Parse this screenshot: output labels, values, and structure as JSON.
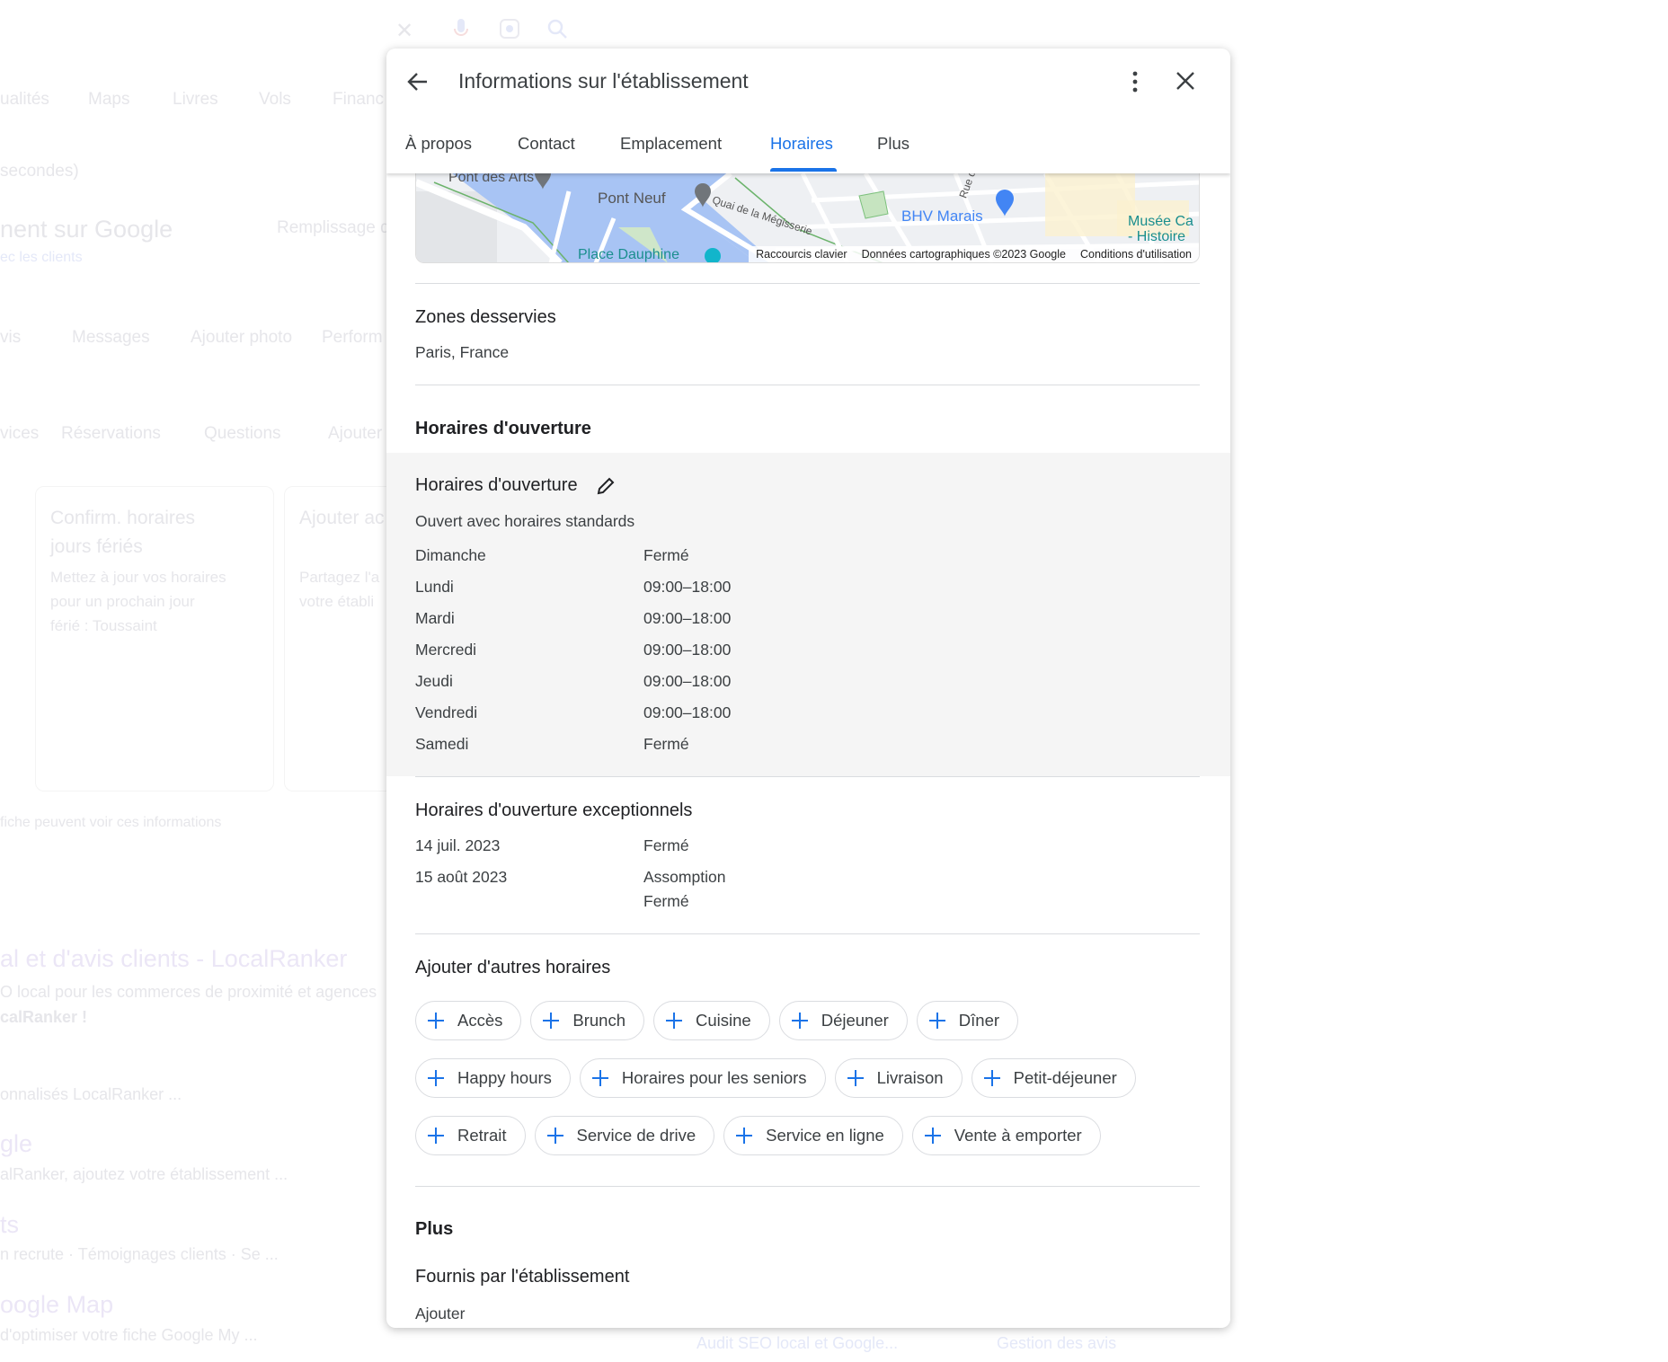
{
  "background": {
    "nav_chips": [
      "ualités",
      "Maps",
      "Livres",
      "Vols",
      "Financ"
    ],
    "result_stats": "secondes)",
    "profile_title": "nent sur Google",
    "profile_fill": "Remplissage d",
    "profile_link": "ec les clients",
    "actions_row1": [
      "vis",
      "Messages",
      "Ajouter photo",
      "Perform"
    ],
    "actions_row2": [
      "vices",
      "Réservations",
      "Questions",
      "Ajouter"
    ],
    "card1": {
      "title1": "Confirm. horaires",
      "title2": "jours fériés",
      "desc1": "Mettez à jour vos horaires",
      "desc2": "pour un prochain jour",
      "desc3": "férié : Toussaint"
    },
    "card2": {
      "title": "Ajouter ac",
      "desc1": "Partagez l'a",
      "desc2": "votre établi"
    },
    "notice": "fiche peuvent voir ces informations",
    "results": [
      {
        "title": "al et d'avis clients - LocalRanker",
        "snippet1": "O local pour les commerces de proximité et agences",
        "snippet2": "calRanker !"
      },
      {
        "title": "",
        "snippet1": "onnalisés LocalRanker ..."
      },
      {
        "title": "gle",
        "snippet1": "alRanker, ajoutez votre établissement ..."
      },
      {
        "title": "ts",
        "snippet1": "n recrute · Témoignages clients · Se ..."
      },
      {
        "title": "oogle Map",
        "snippet1": "d'optimiser votre fiche Google My ..."
      }
    ],
    "bottom_links": [
      "Audit SEO local et Google...",
      "Gestion des avis"
    ]
  },
  "dialog": {
    "title": "Informations sur l'établissement",
    "tabs": [
      {
        "label": "À propos"
      },
      {
        "label": "Contact"
      },
      {
        "label": "Emplacement"
      },
      {
        "label": "Horaires",
        "active": true
      },
      {
        "label": "Plus"
      }
    ],
    "map": {
      "labels": [
        "Pont des Arts",
        "Pont Neuf",
        "Quai de la Mégisserie",
        "BHV Marais",
        "Musée Ca",
        "- Histoire",
        "Place Dauphine",
        "Rue d"
      ],
      "attribution": [
        "Raccourcis clavier",
        "Données cartographiques ©2023 Google",
        "Conditions d'utilisation"
      ]
    },
    "zones": {
      "title": "Zones desservies",
      "value": "Paris, France"
    },
    "hours_section_title": "Horaires d'ouverture",
    "hours": {
      "title": "Horaires d'ouverture",
      "status": "Ouvert avec horaires standards",
      "rows": [
        {
          "day": "Dimanche",
          "value": "Fermé"
        },
        {
          "day": "Lundi",
          "value": "09:00–18:00"
        },
        {
          "day": "Mardi",
          "value": "09:00–18:00"
        },
        {
          "day": "Mercredi",
          "value": "09:00–18:00"
        },
        {
          "day": "Jeudi",
          "value": "09:00–18:00"
        },
        {
          "day": "Vendredi",
          "value": "09:00–18:00"
        },
        {
          "day": "Samedi",
          "value": "Fermé"
        }
      ]
    },
    "special": {
      "title": "Horaires d'ouverture exceptionnels",
      "rows": [
        {
          "date": "14 juil. 2023",
          "value": "Fermé"
        },
        {
          "date": "15 août 2023",
          "value": "Assomption",
          "value2": "Fermé"
        }
      ]
    },
    "other": {
      "title": "Ajouter d'autres horaires",
      "chips": [
        [
          "Accès",
          "Brunch",
          "Cuisine",
          "Déjeuner",
          "Dîner"
        ],
        [
          "Happy hours",
          "Horaires pour les seniors",
          "Livraison",
          "Petit-déjeuner"
        ],
        [
          "Retrait",
          "Service de drive",
          "Service en ligne",
          "Vente à emporter"
        ]
      ]
    },
    "plus": {
      "title": "Plus",
      "sub": "Fournis par l'établissement",
      "action": "Ajouter"
    }
  },
  "colors": {
    "accent": "#1a73e8",
    "section_bg": "#f5f5f5",
    "water": "#a8c4f4"
  }
}
